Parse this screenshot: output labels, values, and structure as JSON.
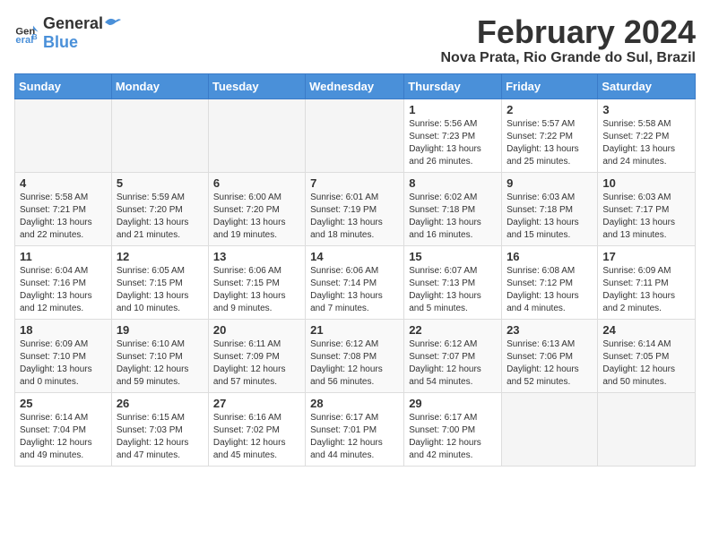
{
  "header": {
    "logo_line1": "General",
    "logo_line2": "Blue",
    "month_year": "February 2024",
    "location": "Nova Prata, Rio Grande do Sul, Brazil"
  },
  "days_of_week": [
    "Sunday",
    "Monday",
    "Tuesday",
    "Wednesday",
    "Thursday",
    "Friday",
    "Saturday"
  ],
  "weeks": [
    [
      {
        "day": "",
        "info": ""
      },
      {
        "day": "",
        "info": ""
      },
      {
        "day": "",
        "info": ""
      },
      {
        "day": "",
        "info": ""
      },
      {
        "day": "1",
        "info": "Sunrise: 5:56 AM\nSunset: 7:23 PM\nDaylight: 13 hours\nand 26 minutes."
      },
      {
        "day": "2",
        "info": "Sunrise: 5:57 AM\nSunset: 7:22 PM\nDaylight: 13 hours\nand 25 minutes."
      },
      {
        "day": "3",
        "info": "Sunrise: 5:58 AM\nSunset: 7:22 PM\nDaylight: 13 hours\nand 24 minutes."
      }
    ],
    [
      {
        "day": "4",
        "info": "Sunrise: 5:58 AM\nSunset: 7:21 PM\nDaylight: 13 hours\nand 22 minutes."
      },
      {
        "day": "5",
        "info": "Sunrise: 5:59 AM\nSunset: 7:20 PM\nDaylight: 13 hours\nand 21 minutes."
      },
      {
        "day": "6",
        "info": "Sunrise: 6:00 AM\nSunset: 7:20 PM\nDaylight: 13 hours\nand 19 minutes."
      },
      {
        "day": "7",
        "info": "Sunrise: 6:01 AM\nSunset: 7:19 PM\nDaylight: 13 hours\nand 18 minutes."
      },
      {
        "day": "8",
        "info": "Sunrise: 6:02 AM\nSunset: 7:18 PM\nDaylight: 13 hours\nand 16 minutes."
      },
      {
        "day": "9",
        "info": "Sunrise: 6:03 AM\nSunset: 7:18 PM\nDaylight: 13 hours\nand 15 minutes."
      },
      {
        "day": "10",
        "info": "Sunrise: 6:03 AM\nSunset: 7:17 PM\nDaylight: 13 hours\nand 13 minutes."
      }
    ],
    [
      {
        "day": "11",
        "info": "Sunrise: 6:04 AM\nSunset: 7:16 PM\nDaylight: 13 hours\nand 12 minutes."
      },
      {
        "day": "12",
        "info": "Sunrise: 6:05 AM\nSunset: 7:15 PM\nDaylight: 13 hours\nand 10 minutes."
      },
      {
        "day": "13",
        "info": "Sunrise: 6:06 AM\nSunset: 7:15 PM\nDaylight: 13 hours\nand 9 minutes."
      },
      {
        "day": "14",
        "info": "Sunrise: 6:06 AM\nSunset: 7:14 PM\nDaylight: 13 hours\nand 7 minutes."
      },
      {
        "day": "15",
        "info": "Sunrise: 6:07 AM\nSunset: 7:13 PM\nDaylight: 13 hours\nand 5 minutes."
      },
      {
        "day": "16",
        "info": "Sunrise: 6:08 AM\nSunset: 7:12 PM\nDaylight: 13 hours\nand 4 minutes."
      },
      {
        "day": "17",
        "info": "Sunrise: 6:09 AM\nSunset: 7:11 PM\nDaylight: 13 hours\nand 2 minutes."
      }
    ],
    [
      {
        "day": "18",
        "info": "Sunrise: 6:09 AM\nSunset: 7:10 PM\nDaylight: 13 hours\nand 0 minutes."
      },
      {
        "day": "19",
        "info": "Sunrise: 6:10 AM\nSunset: 7:10 PM\nDaylight: 12 hours\nand 59 minutes."
      },
      {
        "day": "20",
        "info": "Sunrise: 6:11 AM\nSunset: 7:09 PM\nDaylight: 12 hours\nand 57 minutes."
      },
      {
        "day": "21",
        "info": "Sunrise: 6:12 AM\nSunset: 7:08 PM\nDaylight: 12 hours\nand 56 minutes."
      },
      {
        "day": "22",
        "info": "Sunrise: 6:12 AM\nSunset: 7:07 PM\nDaylight: 12 hours\nand 54 minutes."
      },
      {
        "day": "23",
        "info": "Sunrise: 6:13 AM\nSunset: 7:06 PM\nDaylight: 12 hours\nand 52 minutes."
      },
      {
        "day": "24",
        "info": "Sunrise: 6:14 AM\nSunset: 7:05 PM\nDaylight: 12 hours\nand 50 minutes."
      }
    ],
    [
      {
        "day": "25",
        "info": "Sunrise: 6:14 AM\nSunset: 7:04 PM\nDaylight: 12 hours\nand 49 minutes."
      },
      {
        "day": "26",
        "info": "Sunrise: 6:15 AM\nSunset: 7:03 PM\nDaylight: 12 hours\nand 47 minutes."
      },
      {
        "day": "27",
        "info": "Sunrise: 6:16 AM\nSunset: 7:02 PM\nDaylight: 12 hours\nand 45 minutes."
      },
      {
        "day": "28",
        "info": "Sunrise: 6:17 AM\nSunset: 7:01 PM\nDaylight: 12 hours\nand 44 minutes."
      },
      {
        "day": "29",
        "info": "Sunrise: 6:17 AM\nSunset: 7:00 PM\nDaylight: 12 hours\nand 42 minutes."
      },
      {
        "day": "",
        "info": ""
      },
      {
        "day": "",
        "info": ""
      }
    ]
  ]
}
